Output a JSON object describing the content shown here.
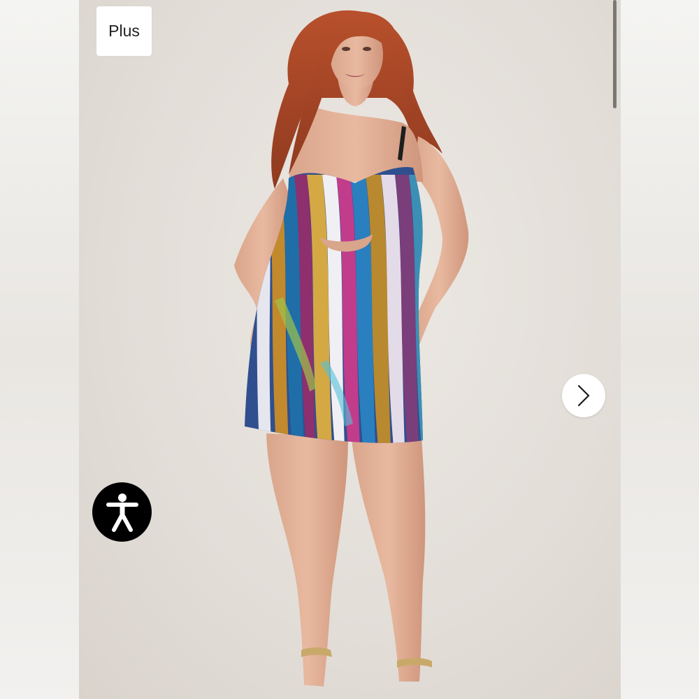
{
  "badge": {
    "label": "Plus"
  },
  "gallery": {
    "next_icon": "chevron-right-icon",
    "photo_subject": "model-wearing-sequin-mini-dress"
  },
  "accessibility": {
    "icon": "accessibility-person-icon"
  },
  "colors": {
    "page_bg": "#f1efed",
    "badge_bg": "#ffffff",
    "accessibility_bg": "#000000",
    "next_button_bg": "#ffffff"
  }
}
